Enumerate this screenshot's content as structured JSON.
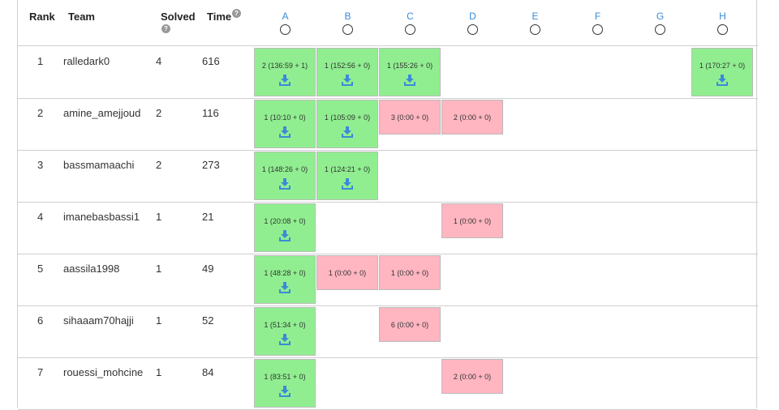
{
  "headers": {
    "rank": "Rank",
    "team": "Team",
    "solved": "Solved",
    "time": "Time",
    "help_glyph": "?"
  },
  "problems": [
    "A",
    "B",
    "C",
    "D",
    "E",
    "F",
    "G",
    "H"
  ],
  "colors": {
    "solved": "#90ee90",
    "tried": "#ffb6c1",
    "link": "#3b8ad8",
    "download_icon": "#3b8ad8"
  },
  "rows": [
    {
      "rank": "1",
      "team": "ralledark0",
      "solved": "4",
      "time": "616",
      "cells": [
        {
          "col": 0,
          "status": "solved",
          "text": "2 (136:59 + 1)"
        },
        {
          "col": 1,
          "status": "solved",
          "text": "1 (152:56 + 0)"
        },
        {
          "col": 2,
          "status": "solved",
          "text": "1 (155:26 + 0)"
        },
        {
          "col": 7,
          "status": "solved",
          "text": "1 (170:27 + 0)"
        }
      ]
    },
    {
      "rank": "2",
      "team": "amine_amejjoud",
      "solved": "2",
      "time": "116",
      "cells": [
        {
          "col": 0,
          "status": "solved",
          "text": "1 (10:10 + 0)"
        },
        {
          "col": 1,
          "status": "solved",
          "text": "1 (105:09 + 0)"
        },
        {
          "col": 2,
          "status": "tried",
          "text": "3 (0:00 + 0)"
        },
        {
          "col": 3,
          "status": "tried",
          "text": "2 (0:00 + 0)"
        }
      ]
    },
    {
      "rank": "3",
      "team": "bassmamaachi",
      "solved": "2",
      "time": "273",
      "cells": [
        {
          "col": 0,
          "status": "solved",
          "text": "1 (148:26 + 0)"
        },
        {
          "col": 1,
          "status": "solved",
          "text": "1 (124:21 + 0)"
        }
      ]
    },
    {
      "rank": "4",
      "team": "imanebasbassi1",
      "solved": "1",
      "time": "21",
      "cells": [
        {
          "col": 0,
          "status": "solved",
          "text": "1 (20:08 + 0)"
        },
        {
          "col": 3,
          "status": "tried",
          "text": "1 (0:00 + 0)"
        }
      ]
    },
    {
      "rank": "5",
      "team": "aassila1998",
      "solved": "1",
      "time": "49",
      "cells": [
        {
          "col": 0,
          "status": "solved",
          "text": "1 (48:28 + 0)"
        },
        {
          "col": 1,
          "status": "tried",
          "text": "1 (0:00 + 0)"
        },
        {
          "col": 2,
          "status": "tried",
          "text": "1 (0:00 + 0)"
        }
      ]
    },
    {
      "rank": "6",
      "team": "sihaaam70hajji",
      "solved": "1",
      "time": "52",
      "cells": [
        {
          "col": 0,
          "status": "solved",
          "text": "1 (51:34 + 0)"
        },
        {
          "col": 2,
          "status": "tried",
          "text": "6 (0:00 + 0)"
        }
      ]
    },
    {
      "rank": "7",
      "team": "rouessi_mohcine",
      "solved": "1",
      "time": "84",
      "cells": [
        {
          "col": 0,
          "status": "solved",
          "text": "1 (83:51 + 0)"
        },
        {
          "col": 3,
          "status": "tried",
          "text": "2 (0:00 + 0)"
        }
      ]
    }
  ]
}
